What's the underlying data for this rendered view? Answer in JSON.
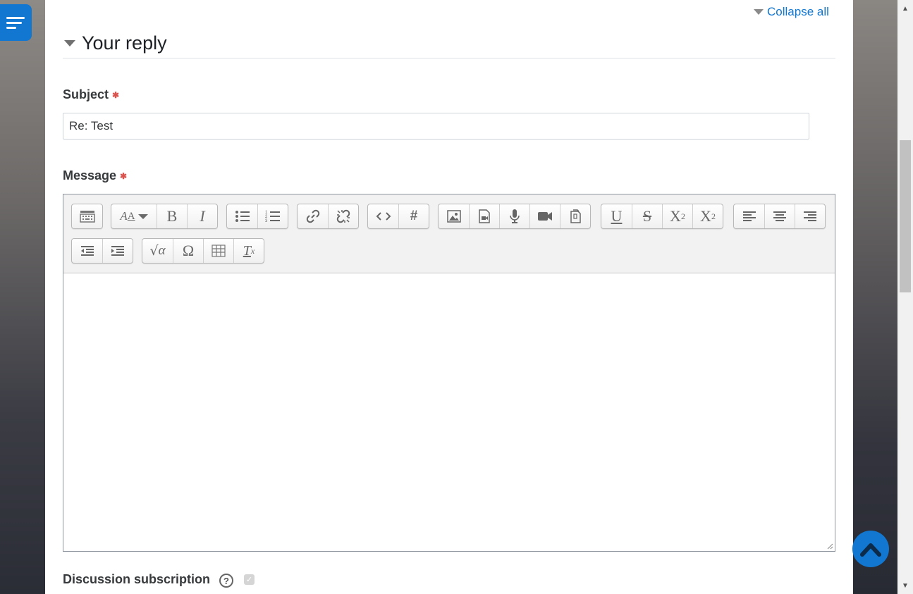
{
  "nav": {
    "drawer_icon": "drawer-toggle-icon"
  },
  "header": {
    "collapse_all": "Collapse all"
  },
  "section": {
    "title": "Your reply"
  },
  "subject": {
    "label": "Subject",
    "value": "Re: Test"
  },
  "message": {
    "label": "Message"
  },
  "toolbar": {
    "groups": [
      [
        "show-more-buttons-icon"
      ],
      [
        "font-size-icon",
        "bold-icon",
        "italic-icon"
      ],
      [
        "unordered-list-icon",
        "ordered-list-icon"
      ],
      [
        "link-icon",
        "unlink-icon"
      ],
      [
        "code-icon",
        "hashtag-icon"
      ],
      [
        "image-icon",
        "media-icon",
        "record-audio-icon",
        "record-video-icon",
        "manage-files-icon"
      ],
      [
        "underline-icon",
        "strikethrough-icon",
        "subscript-icon",
        "superscript-icon"
      ],
      [
        "align-left-icon",
        "align-center-icon",
        "align-right-icon"
      ],
      [
        "outdent-icon",
        "indent-icon"
      ],
      [
        "equation-icon",
        "special-character-icon",
        "table-icon",
        "clear-formatting-icon"
      ]
    ]
  },
  "subscription": {
    "label": "Discussion subscription",
    "checked": true
  },
  "colors": {
    "accent": "#1177d1",
    "required": "#d9534f"
  }
}
